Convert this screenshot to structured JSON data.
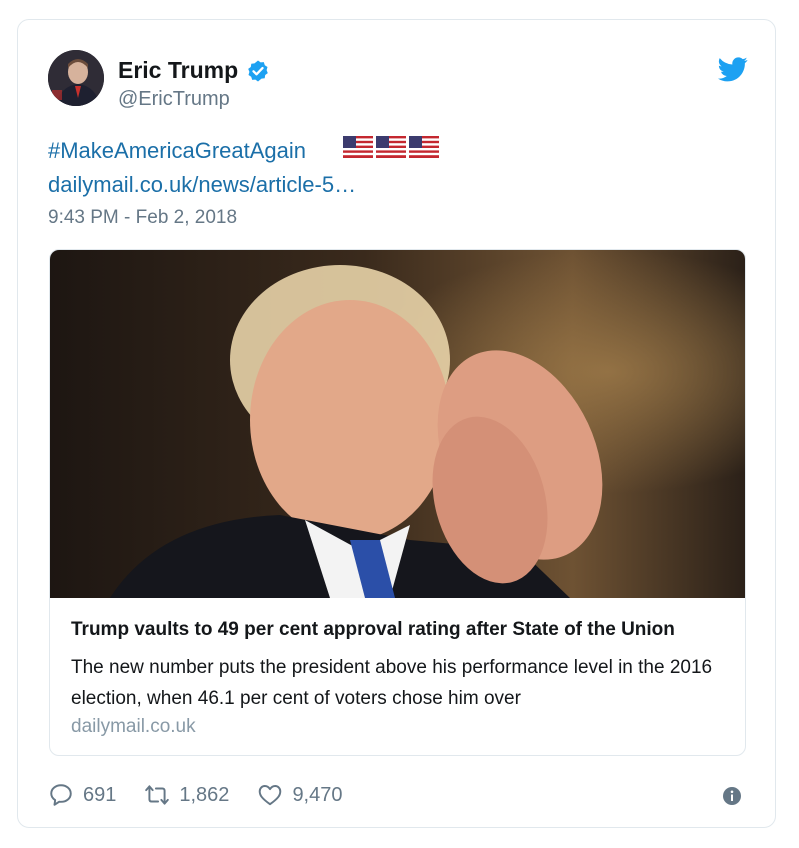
{
  "author": {
    "display_name": "Eric Trump",
    "handle": "@EricTrump",
    "verified": true
  },
  "tweet": {
    "hashtag": "#MakeAmericaGreatAgain",
    "emoji": [
      "us-flag",
      "us-flag",
      "us-flag"
    ],
    "link": "dailymail.co.uk/news/article-5…",
    "timestamp": "9:43 PM - Feb 2, 2018"
  },
  "card": {
    "title": "Trump vaults to 49 per cent approval rating after State of the Union",
    "description": "The new number puts the president above his performance level in the 2016 election, when 46.1 per cent of voters chose him over",
    "domain": "dailymail.co.uk"
  },
  "actions": {
    "replies": "691",
    "retweets": "1,862",
    "likes": "9,470"
  },
  "colors": {
    "link": "#1b6fa8",
    "secondary_text": "#657786",
    "twitter_blue": "#1da1f2",
    "border": "#e1e8ed"
  }
}
